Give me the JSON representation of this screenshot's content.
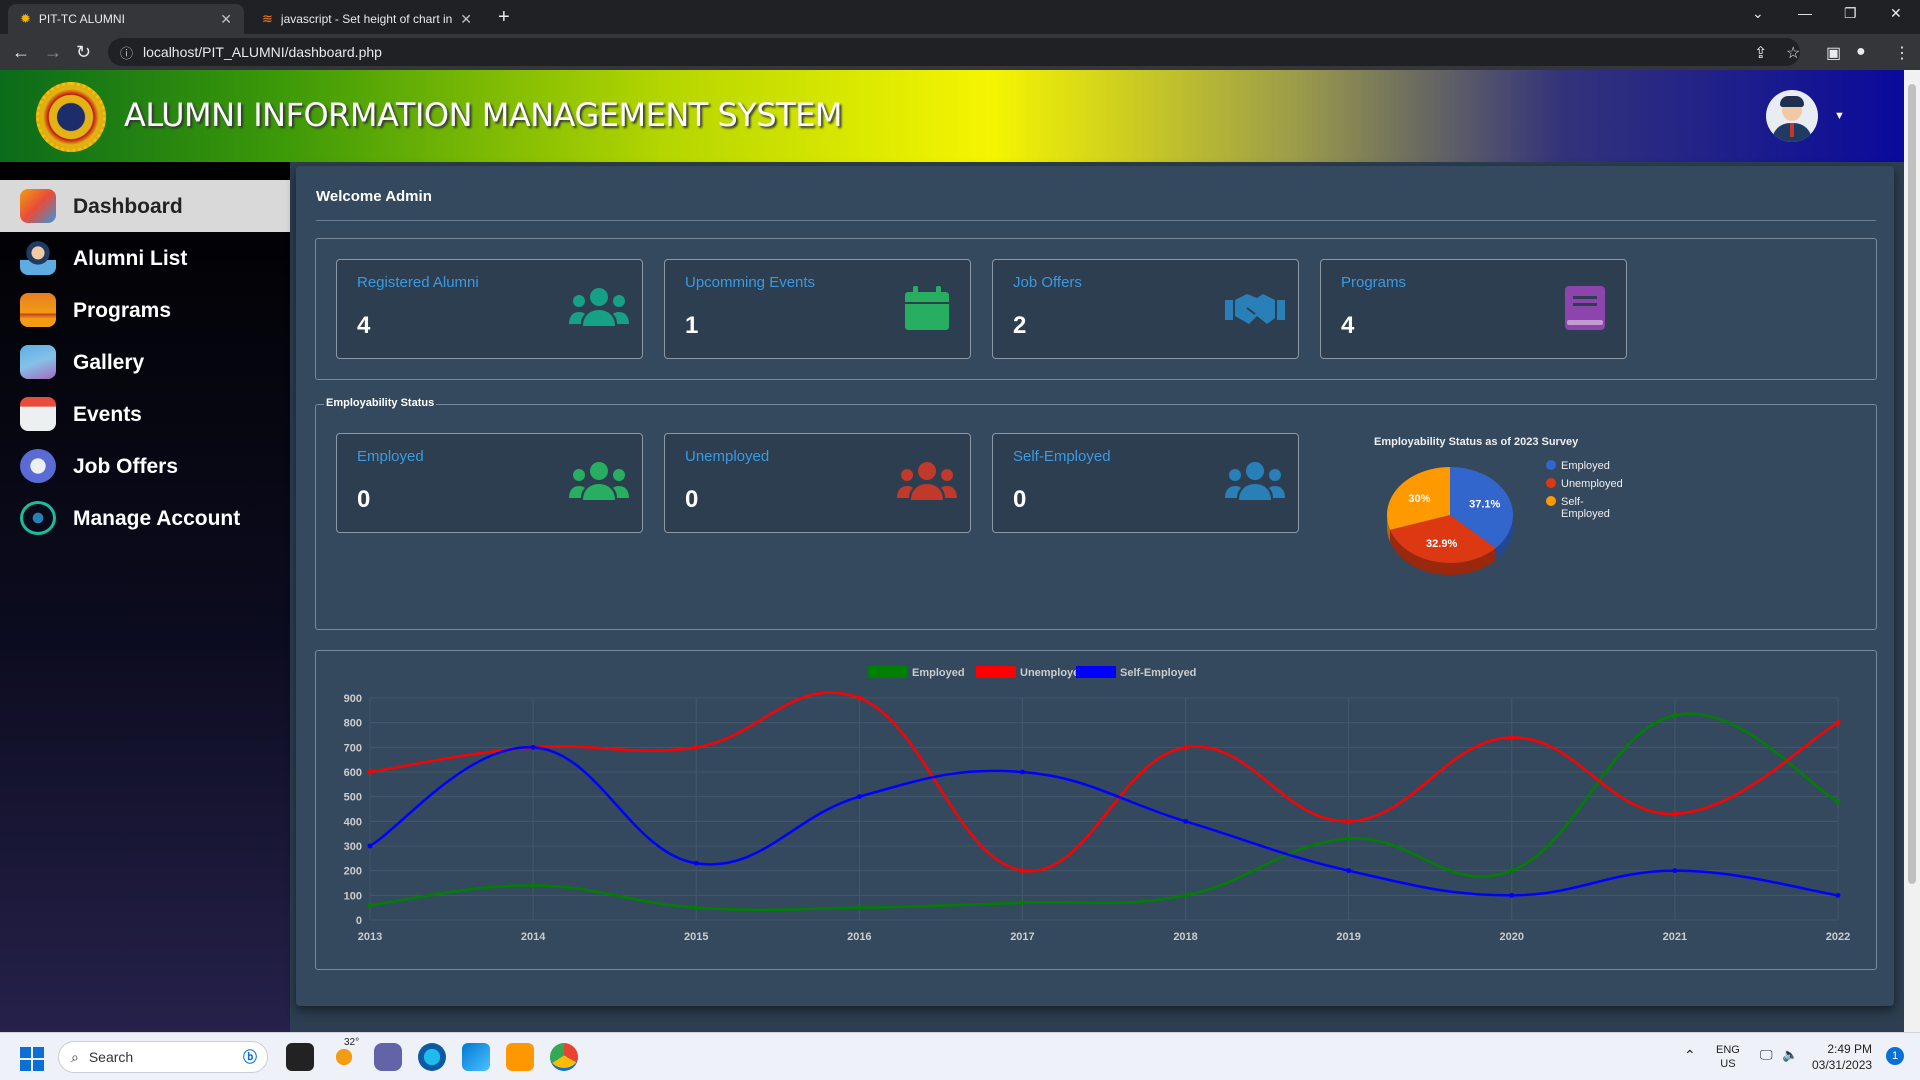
{
  "browser": {
    "tabs": [
      {
        "label": "PIT-TC ALUMNI",
        "icon": "gear-favicon-icon"
      },
      {
        "label": "javascript - Set height of chart in",
        "icon": "stackoverflow-favicon-icon"
      }
    ],
    "url": "localhost/PIT_ALUMNI/dashboard.php"
  },
  "header": {
    "title": "ALUMNI INFORMATION MANAGEMENT SYSTEM"
  },
  "sidebar": {
    "items": [
      {
        "label": "Dashboard",
        "active": true,
        "icon": "dashboard-chart-icon"
      },
      {
        "label": "Alumni List",
        "icon": "graduate-icon"
      },
      {
        "label": "Programs",
        "icon": "briefcase-icon"
      },
      {
        "label": "Gallery",
        "icon": "image-icon"
      },
      {
        "label": "Events",
        "icon": "calendar-icon"
      },
      {
        "label": "Job Offers",
        "icon": "job-search-icon"
      },
      {
        "label": "Manage Account",
        "icon": "account-settings-icon"
      }
    ]
  },
  "main": {
    "welcome": "Welcome Admin",
    "summary_cards": [
      {
        "title": "Registered Alumni",
        "value": "4",
        "icon": "users-icon",
        "color": "#16a085"
      },
      {
        "title": "Upcomming Events",
        "value": "1",
        "icon": "calendar-icon",
        "color": "#27ae60"
      },
      {
        "title": "Job Offers",
        "value": "2",
        "icon": "handshake-icon",
        "color": "#2980b9"
      },
      {
        "title": "Programs",
        "value": "4",
        "icon": "book-icon",
        "color": "#8e44ad"
      }
    ],
    "employability": {
      "legend": "Employability Status",
      "cards": [
        {
          "title": "Employed",
          "value": "0",
          "icon": "users-icon",
          "color": "#27ae60"
        },
        {
          "title": "Unemployed",
          "value": "0",
          "icon": "users-icon",
          "color": "#c0392b"
        },
        {
          "title": "Self-Employed",
          "value": "0",
          "icon": "users-icon",
          "color": "#2980b9"
        }
      ]
    }
  },
  "chart_data": [
    {
      "type": "pie",
      "title": "Employability Status as of 2023 Survey",
      "categories": [
        "Employed",
        "Unemployed",
        "Self-Employed"
      ],
      "values": [
        37.1,
        32.9,
        30
      ],
      "labels": [
        "37.1%",
        "32.9%",
        "30%"
      ],
      "colors": [
        "#3366cc",
        "#dc3912",
        "#ff9900"
      ],
      "legend_position": "right"
    },
    {
      "type": "line",
      "x": [
        "2013",
        "2014",
        "2015",
        "2016",
        "2017",
        "2018",
        "2019",
        "2020",
        "2021",
        "2022"
      ],
      "series": [
        {
          "name": "Employed",
          "color": "#008000",
          "values": [
            60,
            140,
            50,
            50,
            70,
            100,
            330,
            200,
            830,
            480
          ]
        },
        {
          "name": "Unemployed",
          "color": "#ff0000",
          "values": [
            600,
            700,
            700,
            900,
            200,
            700,
            400,
            740,
            430,
            800
          ]
        },
        {
          "name": "Self-Employed",
          "color": "#0000ff",
          "values": [
            300,
            700,
            230,
            500,
            600,
            400,
            200,
            100,
            200,
            100
          ]
        }
      ],
      "yticks": [
        "900",
        "800",
        "700",
        "600",
        "500",
        "400",
        "300",
        "200",
        "100",
        "0"
      ],
      "ylim": [
        0,
        900
      ],
      "legend_position": "top",
      "grid": true
    }
  ],
  "taskbar": {
    "search_placeholder": "Search",
    "weather": "32°",
    "lang_line1": "ENG",
    "lang_line2": "US",
    "time": "2:49 PM",
    "date": "03/31/2023",
    "notification_count": "1"
  }
}
